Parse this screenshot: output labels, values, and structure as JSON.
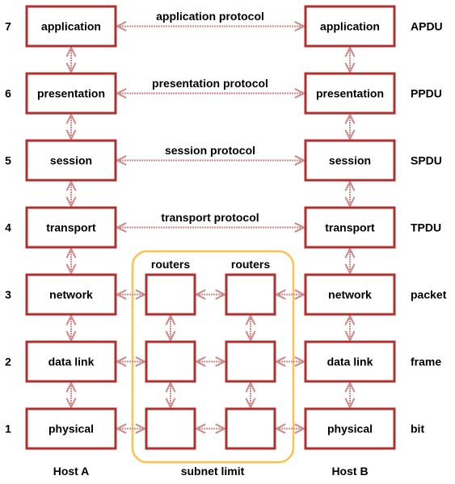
{
  "colors": {
    "box_border": "#b03030",
    "arrow": "#d08a8a",
    "subnet_border": "#ffc04d"
  },
  "layers": [
    {
      "number": "7",
      "left": "application",
      "right": "application",
      "pdu": "APDU",
      "protocol": "application protocol"
    },
    {
      "number": "6",
      "left": "presentation",
      "right": "presentation",
      "pdu": "PPDU",
      "protocol": "presentation protocol"
    },
    {
      "number": "5",
      "left": "session",
      "right": "session",
      "pdu": "SPDU",
      "protocol": "session protocol"
    },
    {
      "number": "4",
      "left": "transport",
      "right": "transport",
      "pdu": "TPDU",
      "protocol": "transport protocol"
    },
    {
      "number": "3",
      "left": "network",
      "right": "network",
      "pdu": "packet",
      "protocol": ""
    },
    {
      "number": "2",
      "left": "data link",
      "right": "data link",
      "pdu": "frame",
      "protocol": ""
    },
    {
      "number": "1",
      "left": "physical",
      "right": "physical",
      "pdu": "bit",
      "protocol": ""
    }
  ],
  "routers": {
    "label_1": "routers",
    "label_2": "routers"
  },
  "footer": {
    "host_a": "Host A",
    "subnet": "subnet limit",
    "host_b": "Host B"
  }
}
